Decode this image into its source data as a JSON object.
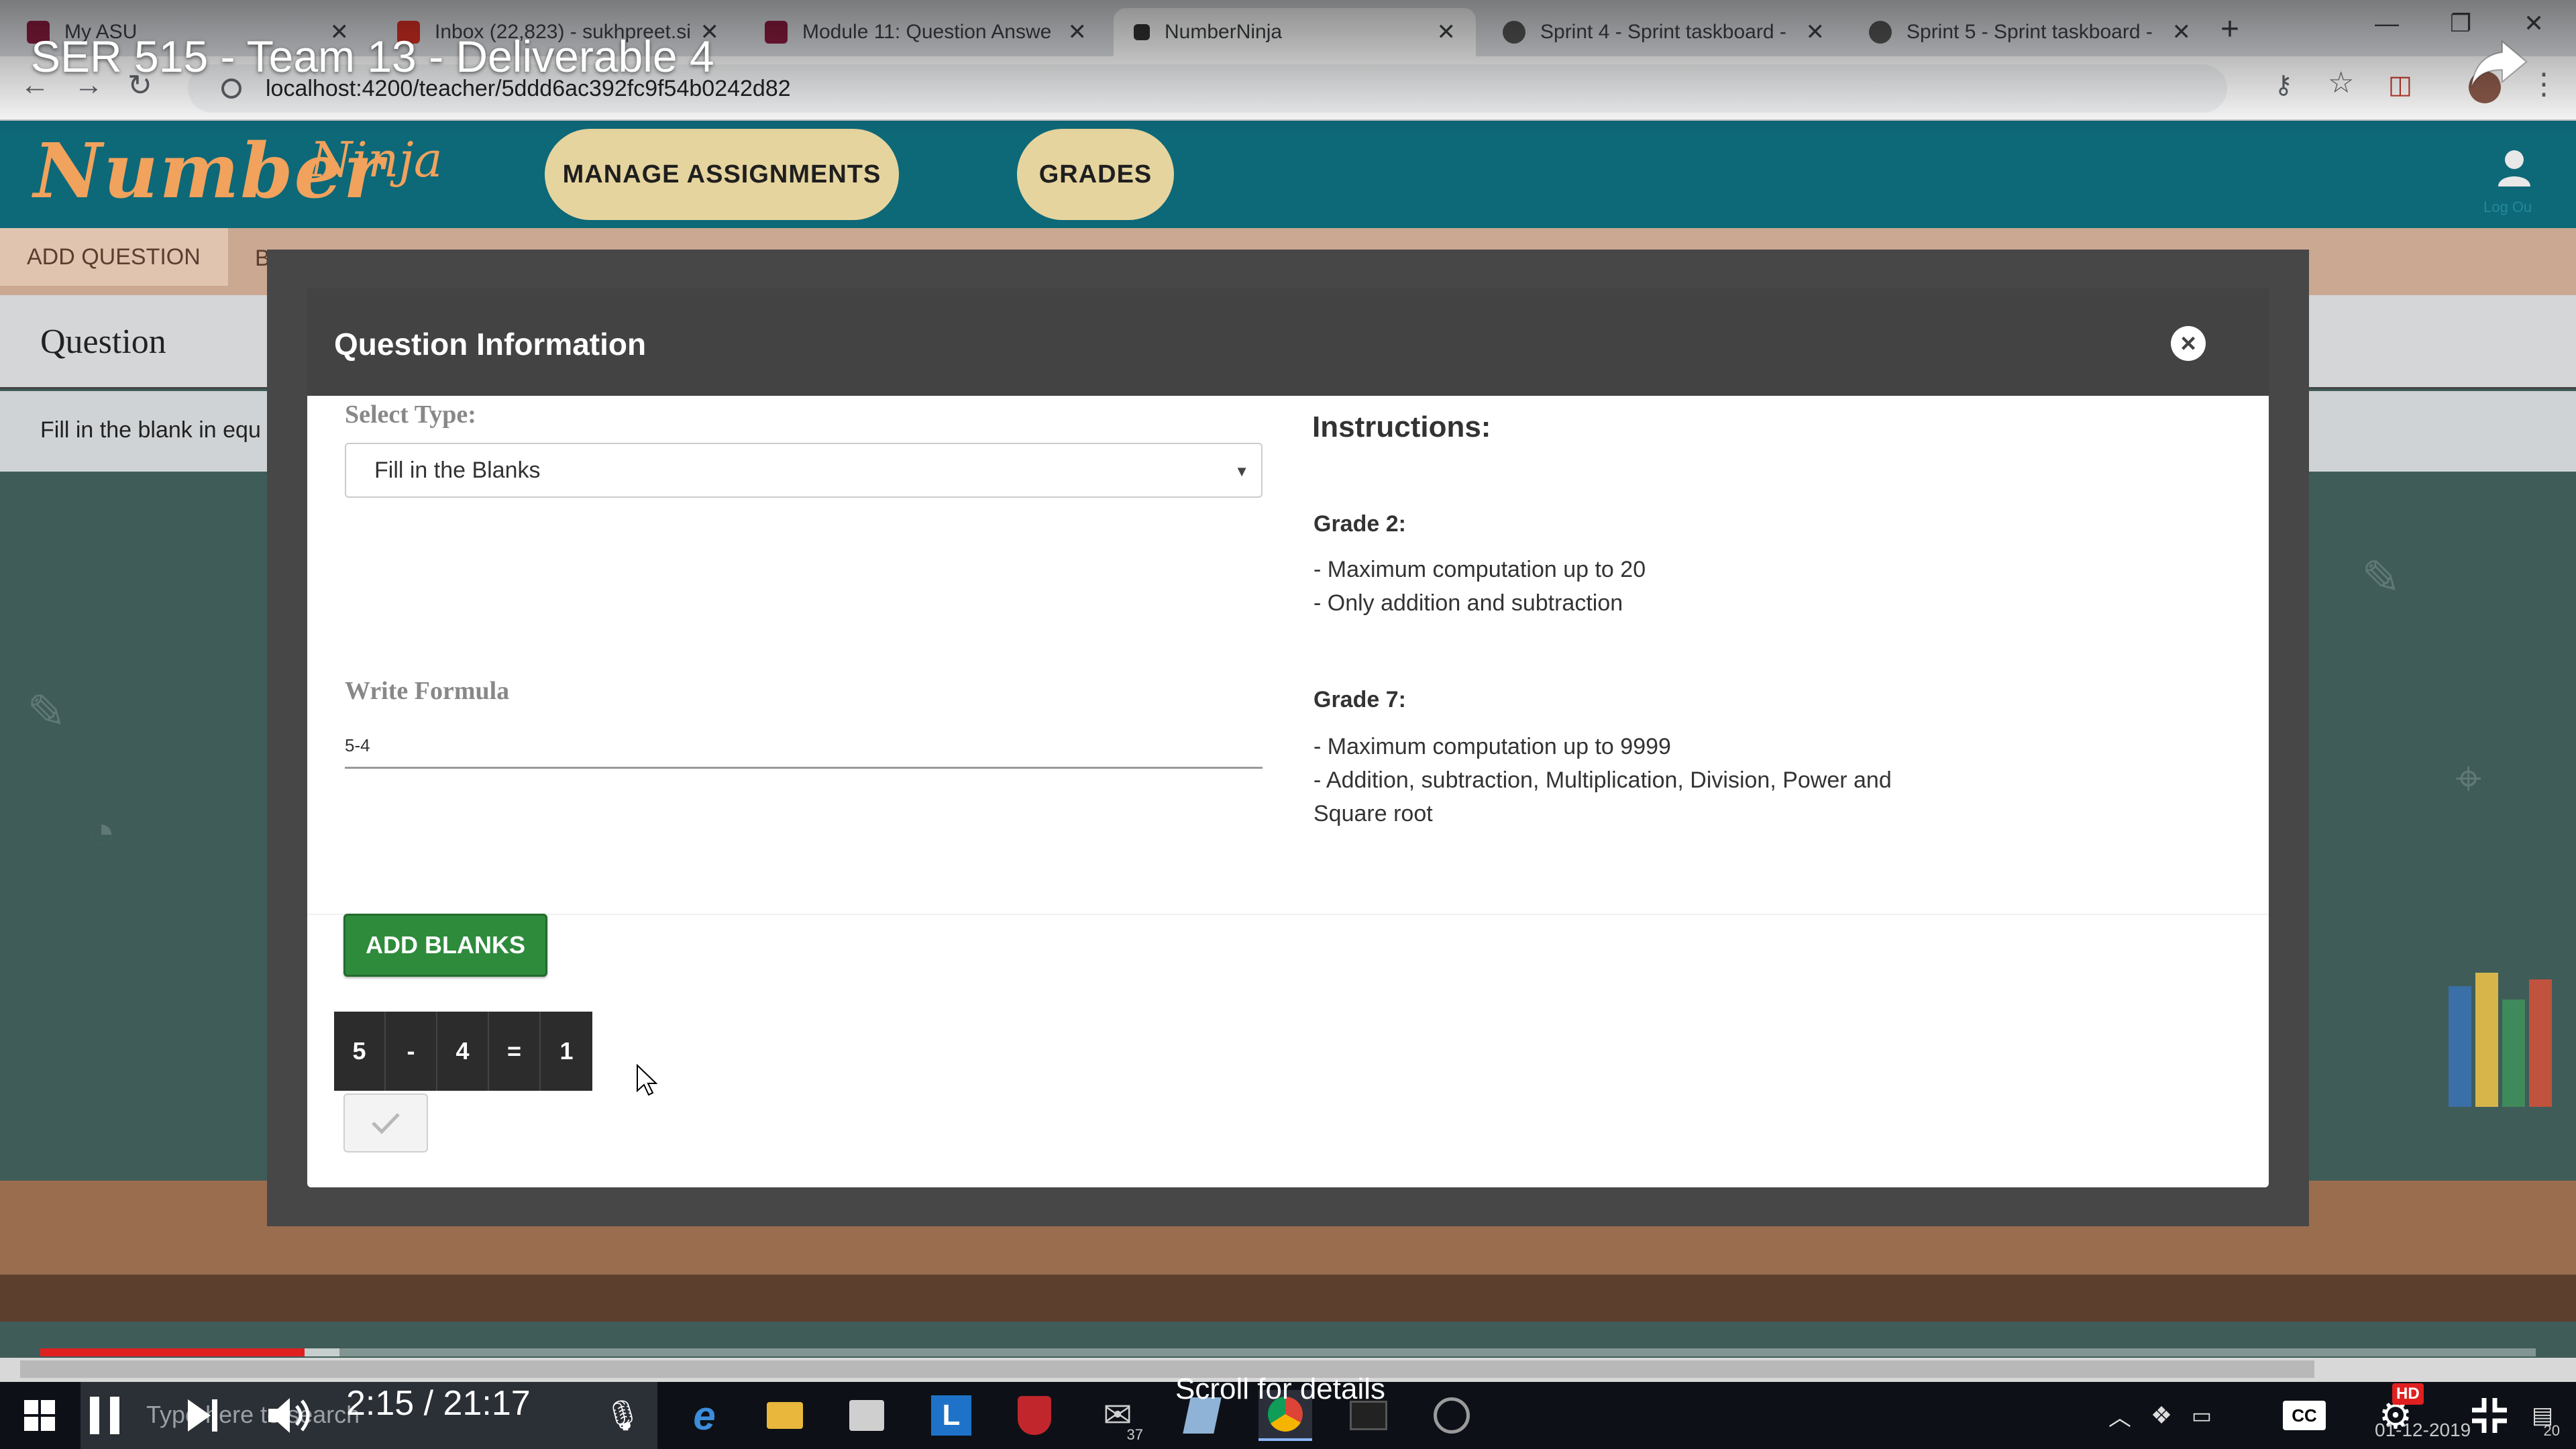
{
  "browser": {
    "tabs": [
      {
        "label": "My ASU",
        "active": false,
        "favicon_color": "#8c1d40"
      },
      {
        "label": "Inbox (22,823) - sukhpreet.si",
        "active": false,
        "favicon_color": "#d93025"
      },
      {
        "label": "Module 11: Question Answe",
        "active": false,
        "favicon_color": "#8c1d40"
      },
      {
        "label": "NumberNinja",
        "active": true,
        "favicon_color": "#333333"
      },
      {
        "label": "Sprint 4 - Sprint taskboard -",
        "active": false,
        "favicon_color": "#555555"
      },
      {
        "label": "Sprint 5 - Sprint taskboard -",
        "active": false,
        "favicon_color": "#555555"
      }
    ],
    "url": "localhost:4200/teacher/5ddd6ac392fc9f54b0242d82"
  },
  "video": {
    "title": "SER 515 - Team 13 - Deliverable 4",
    "time": "2:15 / 21:17",
    "progress_fraction": 0.106,
    "buffered_fraction": 0.12,
    "scroll_hint": "Scroll for details",
    "hd_badge": "HD"
  },
  "app": {
    "logo_main": "Number",
    "logo_sup": "Ninja",
    "nav": {
      "manage_assignments": "MANAGE ASSIGNMENTS",
      "grades": "GRADES"
    },
    "login_label": "Log Ou",
    "brand_color": "#0d6878",
    "logo_color": "#f1a25c"
  },
  "background_page": {
    "add_question_tab": "ADD QUESTION",
    "second_tab": "B",
    "question_title": "Question",
    "row_text": "Fill in the blank in equ"
  },
  "modal": {
    "title": "Question Information",
    "select_type_label": "Select Type:",
    "select_type_value": "Fill in the Blanks",
    "write_formula_label": "Write Formula",
    "formula_value": "5-4",
    "add_blanks_label": "ADD BLANKS",
    "blanks": [
      "5",
      "-",
      "4",
      "=",
      "1"
    ],
    "instructions": {
      "title": "Instructions:",
      "grade2_heading": "Grade 2:",
      "grade2_lines": [
        "- Maximum computation up to 20",
        "- Only addition and subtraction"
      ],
      "grade7_heading": "Grade 7:",
      "grade7_lines": [
        "- Maximum computation up to 9999",
        "- Addition, subtraction, Multiplication, Division, Power and Square root"
      ]
    },
    "accent_green": "#2e8b3c"
  },
  "taskbar": {
    "search_placeholder": "Type here to search",
    "date": "01-12-2019",
    "mail_count": "37",
    "notif_count": "20"
  }
}
